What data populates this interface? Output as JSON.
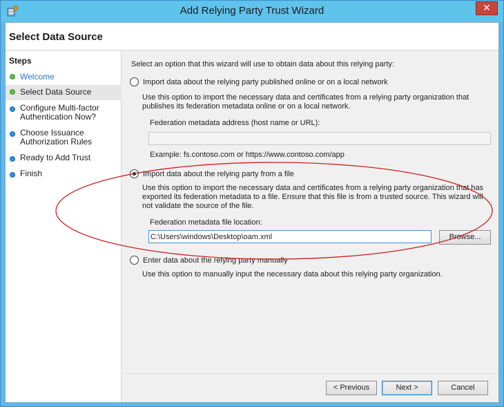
{
  "window": {
    "title": "Add Relying Party Trust Wizard",
    "close_glyph": "✕"
  },
  "header": {
    "page_title": "Select Data Source"
  },
  "steps": {
    "heading": "Steps",
    "items": [
      {
        "label": "Welcome",
        "status": "complete"
      },
      {
        "label": "Select Data Source",
        "status": "current"
      },
      {
        "label": "Configure Multi-factor Authentication Now?",
        "status": "pending"
      },
      {
        "label": "Choose Issuance Authorization Rules",
        "status": "pending"
      },
      {
        "label": "Ready to Add Trust",
        "status": "pending"
      },
      {
        "label": "Finish",
        "status": "pending"
      }
    ]
  },
  "content": {
    "intro": "Select an option that this wizard will use to obtain data about this relying party:",
    "option_online": {
      "label": "Import data about the relying party published online or on a local network",
      "selected": false,
      "description": "Use this option to import the necessary data and certificates from a relying party organization that publishes its federation metadata online or on a local network.",
      "field_label": "Federation metadata address (host name or URL):",
      "field_value": "",
      "example": "Example: fs.contoso.com or https://www.contoso.com/app"
    },
    "option_file": {
      "label": "Import data about the relying party from a file",
      "selected": true,
      "description": "Use this option to import the necessary data and certificates from a relying party organization that has exported its federation metadata to a file. Ensure that this file is from a trusted source.  This wizard will not validate the source of the file.",
      "field_label": "Federation metadata file location:",
      "field_value": "C:\\Users\\windows\\Desktop\\oam.xml",
      "browse_label": "Browse..."
    },
    "option_manual": {
      "label": "Enter data about the relying party manually",
      "selected": false,
      "description": "Use this option to manually input the necessary data about this relying party organization."
    }
  },
  "footer": {
    "previous_label": "< Previous",
    "next_label": "Next >",
    "cancel_label": "Cancel"
  },
  "colors": {
    "title_bar": "#5fc3ec",
    "close_button": "#c7463a",
    "step_complete": "#5bbd4a",
    "step_pending": "#2f8fd8",
    "link_text": "#2a78c8",
    "annotation_ellipse": "#cc1f1f"
  },
  "icons": {
    "app": "server-wizard-icon",
    "close": "close-icon",
    "step_complete": "green-dot-icon",
    "step_pending": "blue-dot-icon"
  }
}
